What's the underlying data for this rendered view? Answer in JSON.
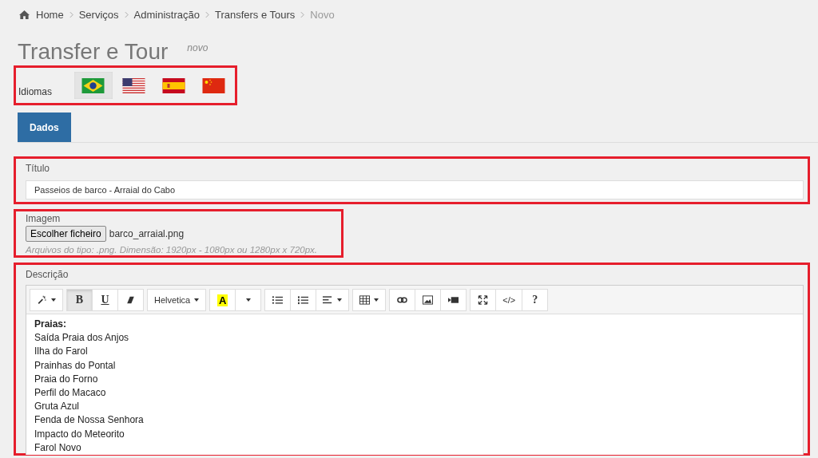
{
  "breadcrumb": [
    {
      "label": "Home",
      "current": false
    },
    {
      "label": "Serviços",
      "current": false
    },
    {
      "label": "Administração",
      "current": false
    },
    {
      "label": "Transfers e Tours",
      "current": false
    },
    {
      "label": "Novo",
      "current": true
    }
  ],
  "page": {
    "title": "Transfer e Tour",
    "subtitle": "novo"
  },
  "languages": {
    "label": "Idiomas",
    "flags": [
      {
        "kind": "br",
        "selected": true
      },
      {
        "kind": "us",
        "selected": false
      },
      {
        "kind": "es",
        "selected": false
      },
      {
        "kind": "cn",
        "selected": false
      }
    ]
  },
  "tabs": [
    {
      "label": "Dados",
      "selected": true
    }
  ],
  "titulo": {
    "label": "Título",
    "value": "Passeios de barco - Arraial do Cabo"
  },
  "imagem": {
    "label": "Imagem",
    "button": "Escolher ficheiro",
    "file": "barco_arraial.png",
    "help": "Arquivos do tipo: .png. Dimensão: 1920px - 1080px ou 1280px x 720px."
  },
  "descricao": {
    "label": "Descrição",
    "toolbar": [
      [
        {
          "kind": "magic",
          "caret": true
        }
      ],
      [
        {
          "kind": "bold",
          "label": "B",
          "selected": true
        },
        {
          "kind": "underline",
          "label": "U",
          "selected": false
        },
        {
          "kind": "eraser",
          "selected": false
        }
      ],
      [
        {
          "kind": "font",
          "label": "Helvetica",
          "caret": true
        }
      ],
      [
        {
          "kind": "color",
          "label": "A"
        },
        {
          "kind": "blank",
          "caret": true
        }
      ],
      [
        {
          "kind": "ul"
        },
        {
          "kind": "ol"
        },
        {
          "kind": "align",
          "caret": true
        }
      ],
      [
        {
          "kind": "table",
          "caret": true
        }
      ],
      [
        {
          "kind": "link"
        },
        {
          "kind": "image"
        },
        {
          "kind": "video"
        }
      ],
      [
        {
          "kind": "fullscreen"
        },
        {
          "kind": "code",
          "label": "</>"
        },
        {
          "kind": "help",
          "label": "?"
        }
      ]
    ],
    "lines": [
      {
        "text": "Praias:",
        "bold": true
      },
      {
        "text": "Saída Praia dos Anjos",
        "bold": false
      },
      {
        "text": "Ilha do Farol",
        "bold": false
      },
      {
        "text": "Prainhas do Pontal",
        "bold": false
      },
      {
        "text": "Praia do Forno",
        "bold": false
      },
      {
        "text": "Perfil do Macaco",
        "bold": false
      },
      {
        "text": "Gruta Azul",
        "bold": false
      },
      {
        "text": "Fenda de Nossa Senhora",
        "bold": false
      },
      {
        "text": "Impacto do Meteorito",
        "bold": false
      },
      {
        "text": "Farol Novo",
        "bold": false
      }
    ]
  }
}
